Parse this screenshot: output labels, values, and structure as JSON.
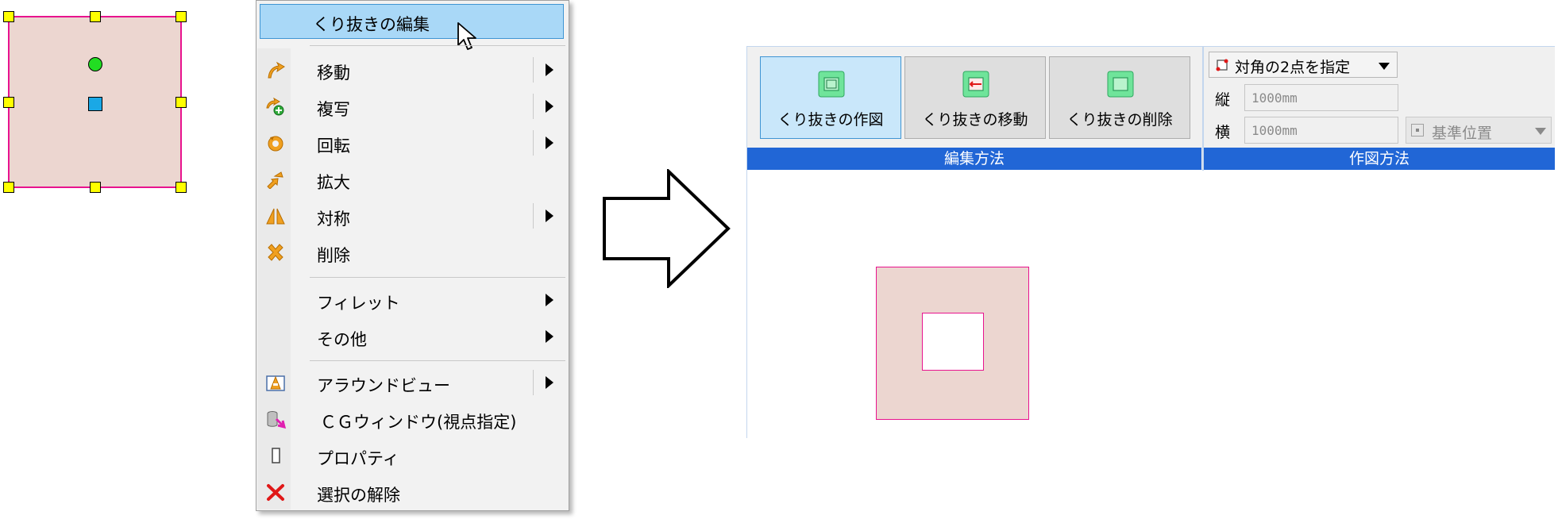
{
  "context_menu": {
    "highlighted_item": "くり抜きの編集",
    "items": [
      {
        "label": "移動",
        "icon": "move-arrow-icon",
        "submenu": true
      },
      {
        "label": "複写",
        "icon": "copy-icon",
        "submenu": true
      },
      {
        "label": "回転",
        "icon": "rotate-icon",
        "submenu": true
      },
      {
        "label": "拡大",
        "icon": "scale-icon",
        "submenu": false
      },
      {
        "label": "対称",
        "icon": "mirror-icon",
        "submenu": true
      },
      {
        "label": "削除",
        "icon": "delete-icon",
        "submenu": false
      },
      {
        "label": "フィレット",
        "icon": "",
        "submenu": true
      },
      {
        "label": "その他",
        "icon": "",
        "submenu": true
      },
      {
        "label": "アラウンドビュー",
        "icon": "around-view-icon",
        "submenu": true
      },
      {
        "label": "ＣＧウィンドウ(視点指定)",
        "icon": "cg-window-icon",
        "submenu": false
      },
      {
        "label": "プロパティ",
        "icon": "properties-icon",
        "submenu": false
      },
      {
        "label": "選択の解除",
        "icon": "deselect-icon",
        "submenu": false
      }
    ]
  },
  "ribbon": {
    "buttons": [
      {
        "label": "くり抜きの作図",
        "active": true
      },
      {
        "label": "くり抜きの移動",
        "active": false
      },
      {
        "label": "くり抜きの削除",
        "active": false
      }
    ],
    "groups": {
      "edit_method": "編集方法",
      "draw_method": "作図方法"
    },
    "method_select": "対角の2点を指定",
    "height_label": "縦",
    "height_value": "1000mm",
    "width_label": "横",
    "width_value": "1000mm",
    "base_position": "基準位置"
  },
  "colors": {
    "shape_fill": "#ecd6d0",
    "shape_stroke": "#e8138e",
    "handle_yellow": "#ffff00",
    "ribbon_group_bar": "#2166d6",
    "menu_highlight": "#a9d8f7"
  }
}
